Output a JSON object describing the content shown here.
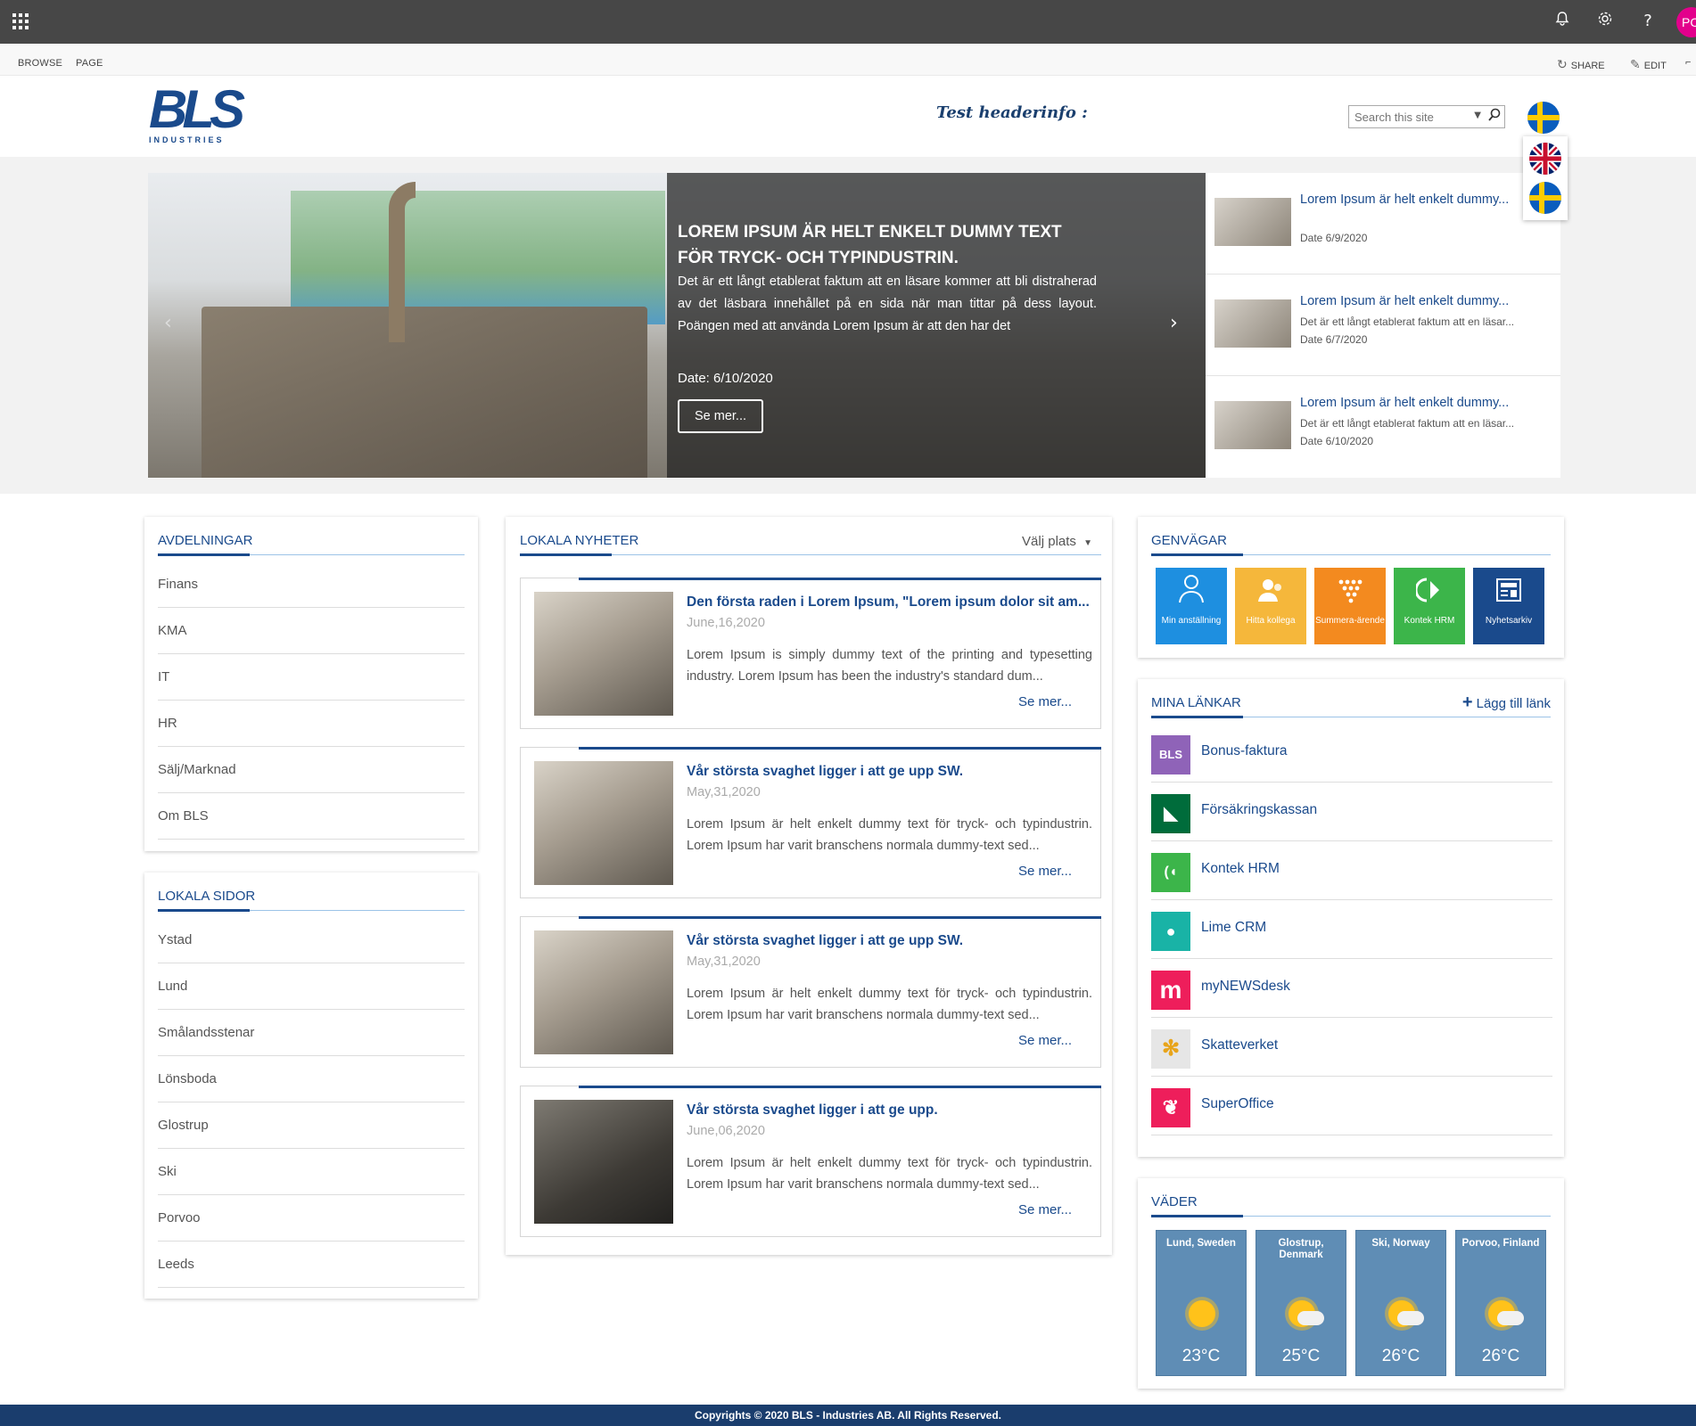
{
  "ribbon": {
    "browse": "BROWSE",
    "page": "PAGE",
    "share": "SHARE",
    "edit": "EDIT"
  },
  "suitebar": {
    "avatar_initials": "PC"
  },
  "header": {
    "logo_text": "BLS",
    "logo_sub": "INDUSTRIES",
    "headerinfo": "Test headerinfo :",
    "search_placeholder": "Search this site"
  },
  "slider": {
    "title": "LOREM IPSUM ÄR HELT ENKELT DUMMY TEXT FÖR TRYCK- OCH TYPINDUSTRIN.",
    "description": "Det är ett långt etablerat faktum att en läsare kommer att bli distraherad av det läsbara innehållet på en sida när man tittar på dess layout. Poängen med att använda Lorem Ipsum är att den har det",
    "date": "Date: 6/10/2020",
    "button": "Se mer..."
  },
  "side_news": [
    {
      "title": "Lorem Ipsum är helt enkelt dummy...",
      "desc": "",
      "date": "Date 6/9/2020"
    },
    {
      "title": "Lorem Ipsum är helt enkelt dummy...",
      "desc": "Det är ett långt etablerat faktum att en läsar...",
      "date": "Date 6/7/2020"
    },
    {
      "title": "Lorem Ipsum är helt enkelt dummy...",
      "desc": "Det är ett långt etablerat faktum att en läsar...",
      "date": "Date 6/10/2020"
    }
  ],
  "avdelningar": {
    "title": "AVDELNINGAR",
    "items": [
      "Finans",
      "KMA",
      "IT",
      "HR",
      "Sälj/Marknad",
      "Om BLS"
    ]
  },
  "lokala_sidor": {
    "title": "LOKALA SIDOR",
    "items": [
      "Ystad",
      "Lund",
      "Smålandsstenar",
      "Lönsboda",
      "Glostrup",
      "Ski",
      "Porvoo",
      "Leeds"
    ]
  },
  "lokala_nyheter": {
    "title": "LOKALA NYHETER",
    "valj_plats": "Välj plats",
    "items": [
      {
        "title": "Den första raden i Lorem Ipsum, \"Lorem ipsum dolor sit am...",
        "date": "June,16,2020",
        "text": "Lorem Ipsum is simply dummy text of the printing and typesetting industry. Lorem Ipsum has been the industry's standard dum...",
        "more": "Se mer..."
      },
      {
        "title": "Vår största svaghet ligger i att ge upp SW.",
        "date": "May,31,2020",
        "text": "Lorem Ipsum är helt enkelt dummy text för tryck- och typindustrin. Lorem Ipsum har varit branschens normala dummy-text sed...",
        "more": "Se mer..."
      },
      {
        "title": "Vår största svaghet ligger i att ge upp SW.",
        "date": "May,31,2020",
        "text": "Lorem Ipsum är helt enkelt dummy text för tryck- och typindustrin. Lorem Ipsum har varit branschens normala dummy-text sed...",
        "more": "Se mer..."
      },
      {
        "title": "Vår största svaghet ligger i att ge upp.",
        "date": "June,06,2020",
        "text": "Lorem Ipsum är helt enkelt dummy text för tryck- och typindustrin. Lorem Ipsum har varit branschens normala dummy-text sed...",
        "more": "Se mer..."
      }
    ]
  },
  "genvagar": {
    "title": "GENVÄGAR",
    "tiles": [
      {
        "label": "Min anställning",
        "color": "#1e8fe0",
        "icon": "person-icon"
      },
      {
        "label": "Hitta kollega",
        "color": "#f5b73b",
        "icon": "people-icon"
      },
      {
        "label": "Summera-ärende",
        "color": "#f38a1f",
        "icon": "grid-icon"
      },
      {
        "label": "Kontek HRM",
        "color": "#3cb54a",
        "icon": "kontek-icon"
      },
      {
        "label": "Nyhetsarkiv",
        "color": "#1a4a8c",
        "icon": "news-icon"
      }
    ]
  },
  "mina_lankar": {
    "title": "MINA LÄNKAR",
    "add_label": "Lägg till länk",
    "items": [
      {
        "label": "Bonus-faktura",
        "color": "#8f63b8",
        "glyph": "BLS"
      },
      {
        "label": "Försäkringskassan",
        "color": "#006c3b",
        "glyph": "◣"
      },
      {
        "label": "Kontek HRM",
        "color": "#3cb54a",
        "glyph": "(◖"
      },
      {
        "label": "Lime CRM",
        "color": "#19b3a6",
        "glyph": "●"
      },
      {
        "label": "myNEWSdesk",
        "color": "#ee1e5b",
        "glyph": "m"
      },
      {
        "label": "Skatteverket",
        "color": "#e6e6e6",
        "glyph": "✻"
      },
      {
        "label": "SuperOffice",
        "color": "#ee1e5b",
        "glyph": "❦"
      }
    ]
  },
  "vader": {
    "title": "VÄDER",
    "cities": [
      {
        "city": "Lund, Sweden",
        "temp": "23°C",
        "icon": "sun-icon"
      },
      {
        "city": "Glostrup, Denmark",
        "temp": "25°C",
        "icon": "partly-cloudy-icon"
      },
      {
        "city": "Ski, Norway",
        "temp": "26°C",
        "icon": "partly-cloudy-icon"
      },
      {
        "city": "Porvoo, Finland",
        "temp": "26°C",
        "icon": "partly-cloudy-icon"
      }
    ]
  },
  "footer": {
    "text": "Copyrights © 2020 BLS - Industries AB. All Rights Reserved."
  }
}
